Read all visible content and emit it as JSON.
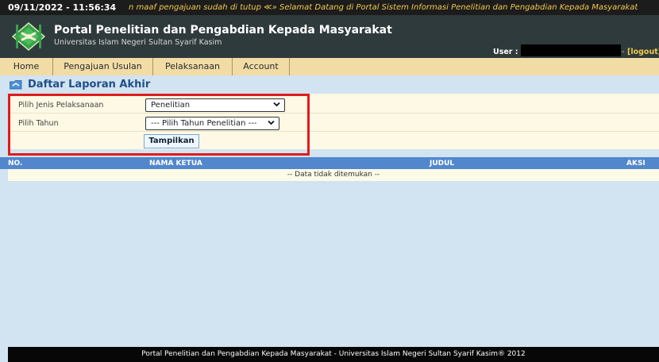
{
  "topbar": {
    "datetime": "09/11/2022 - 11:56:34",
    "marquee": "n maaf pengajuan sudah di tutup ≪» Selamat Datang di Portal Sistem Informasi Penelitian dan Pengabdian Kepada Masyarakat"
  },
  "header": {
    "title": "Portal Penelitian dan Pengabdian Kepada Masyarakat",
    "subtitle": "Universitas Islam Negeri Sultan Syarif Kasim",
    "user_label": "User :",
    "user_sep": "-",
    "logout_label": "[logout]",
    "logo_icon": "uin-logo-icon"
  },
  "nav": {
    "items": [
      {
        "label": "Home"
      },
      {
        "label": "Pengajuan Usulan"
      },
      {
        "label": "Pelaksanaan"
      },
      {
        "label": "Account"
      }
    ]
  },
  "section": {
    "title": "Daftar Laporan Akhir",
    "icon": "report-folder-icon"
  },
  "form": {
    "jenis_label": "Pilih Jenis Pelaksanaan",
    "jenis_value": "Penelitian",
    "tahun_label": "Pilih Tahun",
    "tahun_value": "--- Pilih Tahun Penelitian ---",
    "submit_label": "Tampilkan"
  },
  "table": {
    "columns": [
      "NO.",
      "NAMA KETUA",
      "JUDUL",
      "AKSI"
    ],
    "empty_message": "-- Data tidak ditemukan --"
  },
  "footer": {
    "text": "Portal Penelitian dan Pengabdian Kepada Masyarakat - Universitas Islam Negeri Sultan Syarif Kasim® 2012"
  },
  "colors": {
    "nav_bg": "#f1dca6",
    "table_header": "#5287cd",
    "highlight": "#e01c1c",
    "title_blue": "#1e4f89"
  }
}
